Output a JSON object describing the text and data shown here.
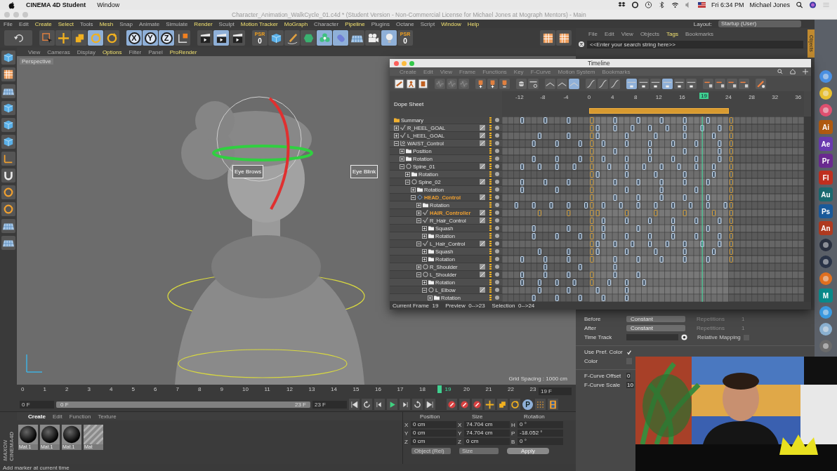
{
  "menubar": {
    "app": "CINEMA 4D Student",
    "menus": [
      "Window"
    ],
    "clock": "Fri 6:34 PM",
    "user": "Michael Jones"
  },
  "window": {
    "title": "Character_Animation_WalkCycle_01.c4d * (Student Version - Non-Commercial License for Michael Jones at Mograph Mentors) - Main"
  },
  "main_menu": [
    {
      "label": "File",
      "highlight": false
    },
    {
      "label": "Edit",
      "highlight": false
    },
    {
      "label": "Create",
      "highlight": true
    },
    {
      "label": "Select",
      "highlight": true
    },
    {
      "label": "Tools",
      "highlight": false
    },
    {
      "label": "Mesh",
      "highlight": true
    },
    {
      "label": "Snap",
      "highlight": false
    },
    {
      "label": "Animate",
      "highlight": false
    },
    {
      "label": "Simulate",
      "highlight": false
    },
    {
      "label": "Render",
      "highlight": true
    },
    {
      "label": "Sculpt",
      "highlight": false
    },
    {
      "label": "Motion Tracker",
      "highlight": true
    },
    {
      "label": "MoGraph",
      "highlight": true
    },
    {
      "label": "Character",
      "highlight": false
    },
    {
      "label": "Pipeline",
      "highlight": true
    },
    {
      "label": "Plugins",
      "highlight": false
    },
    {
      "label": "Octane",
      "highlight": false
    },
    {
      "label": "Script",
      "highlight": false
    },
    {
      "label": "Window",
      "highlight": true
    },
    {
      "label": "Help",
      "highlight": true
    }
  ],
  "layout": {
    "label": "Layout:",
    "value": "Startup (User)"
  },
  "toolbar": [
    {
      "kind": "undo",
      "selected": false
    },
    {
      "kind": "select",
      "selected": false
    },
    {
      "kind": "move",
      "selected": false
    },
    {
      "kind": "scale",
      "selected": false
    },
    {
      "kind": "rotate",
      "selected": true
    },
    {
      "kind": "rotate",
      "selected": false
    },
    {
      "kind": "axis",
      "label": "X",
      "selected": true
    },
    {
      "kind": "axis",
      "label": "Y",
      "selected": true
    },
    {
      "kind": "axis",
      "label": "Z",
      "selected": true
    },
    {
      "kind": "coords",
      "selected": false
    },
    {
      "kind": "clapper",
      "selected": false
    },
    {
      "kind": "clapper",
      "selected": true
    },
    {
      "kind": "clapper",
      "selected": false
    },
    {
      "kind": "psr",
      "label": "PSR",
      "value": "0",
      "selected": false
    },
    {
      "kind": "cube",
      "selected": false
    },
    {
      "kind": "pen",
      "selected": false
    },
    {
      "kind": "gem",
      "selected": false
    },
    {
      "kind": "flower",
      "selected": true
    },
    {
      "kind": "capsule",
      "selected": true
    },
    {
      "kind": "grid",
      "selected": false
    },
    {
      "kind": "camera",
      "selected": false
    },
    {
      "kind": "light",
      "selected": true
    },
    {
      "kind": "psr",
      "label": "PSR",
      "value": "0",
      "selected": false
    }
  ],
  "viewport": {
    "menu": [
      {
        "label": "View",
        "highlight": false
      },
      {
        "label": "Cameras",
        "highlight": false
      },
      {
        "label": "Display",
        "highlight": false
      },
      {
        "label": "Options",
        "highlight": true
      },
      {
        "label": "Filter",
        "highlight": false
      },
      {
        "label": "Panel",
        "highlight": false
      },
      {
        "label": "ProRender",
        "highlight": true
      }
    ],
    "camera": "Perspective",
    "labels": [
      "Eye Brows",
      "Eye Blink"
    ],
    "grid_spacing": "Grid Spacing : 1000 cm"
  },
  "object_manager": {
    "menu": [
      {
        "label": "File",
        "highlight": false
      },
      {
        "label": "Edit",
        "highlight": false
      },
      {
        "label": "View",
        "highlight": false
      },
      {
        "label": "Objects",
        "highlight": false
      },
      {
        "label": "Tags",
        "highlight": true
      },
      {
        "label": "Bookmarks",
        "highlight": false
      }
    ],
    "search": {
      "placeholder": "<<Enter your search string here>>"
    },
    "side_tab": "Objects"
  },
  "attributes": [
    {
      "kind": "dropdown",
      "label": "Before",
      "value": "Constant",
      "side_label": "Repetitions",
      "side_value": "1"
    },
    {
      "kind": "dropdown",
      "label": "After",
      "value": "Constant",
      "side_label": "Repetitions",
      "side_value": "1"
    },
    {
      "kind": "time_track",
      "label": "Time Track",
      "side_label": "Relative Mapping",
      "checked": false
    },
    {
      "kind": "checkbox",
      "label": "Use Pref. Color",
      "checked": true
    },
    {
      "kind": "color",
      "label": "Color"
    },
    {
      "kind": "number",
      "label": "F-Curve Offset",
      "value": "0"
    },
    {
      "kind": "number",
      "label": "F-Curve Scale",
      "value": "10"
    }
  ],
  "timeline": {
    "title": "Timeline",
    "menu": [
      "Create",
      "Edit",
      "View",
      "Frame",
      "Functions",
      "Key",
      "F-Curve",
      "Motion System",
      "Bookmarks"
    ],
    "tools": [
      {
        "kind": "link",
        "selected": false
      },
      {
        "kind": "person",
        "selected": false
      },
      {
        "kind": "film",
        "selected": false
      },
      {
        "kind": "wave",
        "selected": false
      },
      {
        "kind": "wave",
        "selected": false
      },
      {
        "kind": "wave",
        "selected": false
      },
      {
        "kind": "key-add",
        "selected": false
      },
      {
        "kind": "key-add",
        "selected": false
      },
      {
        "kind": "key-remove",
        "selected": false
      },
      {
        "kind": "key-move",
        "selected": false
      },
      {
        "kind": "key-zero",
        "selected": false
      },
      {
        "kind": "ease",
        "selected": false
      },
      {
        "kind": "ease",
        "selected": false
      },
      {
        "kind": "ease",
        "selected": true
      },
      {
        "kind": "curve",
        "selected": false
      },
      {
        "kind": "curve",
        "selected": false
      },
      {
        "kind": "curve",
        "selected": false
      },
      {
        "kind": "tangent",
        "selected": true
      },
      {
        "kind": "tangent",
        "selected": false
      },
      {
        "kind": "tangent",
        "selected": false
      },
      {
        "kind": "tangent",
        "selected": true
      },
      {
        "kind": "tangent",
        "selected": false
      },
      {
        "kind": "tangent",
        "selected": false
      },
      {
        "kind": "lock",
        "selected": false
      },
      {
        "kind": "lock",
        "selected": false
      },
      {
        "kind": "lock",
        "selected": false
      },
      {
        "kind": "lock",
        "selected": false
      },
      {
        "kind": "brush",
        "selected": false
      }
    ],
    "mode": "Dope Sheet",
    "ruler": [
      "-12",
      "-8",
      "-4",
      "0",
      "4",
      "8",
      "12",
      "16",
      "24",
      "28",
      "32",
      "36"
    ],
    "current_frame": "19",
    "rows": [
      {
        "name": "Summary",
        "kind": "summary",
        "selected": false
      },
      {
        "name": "R_HEEL_GOAL",
        "kind": "spline",
        "expanded": false,
        "selected": false
      },
      {
        "name": "L_HEEL_GOAL",
        "kind": "spline",
        "expanded": false,
        "selected": false
      },
      {
        "name": "WAIST_Control",
        "kind": "null",
        "expanded": true,
        "selected": false,
        "children": [
          {
            "name": "Position",
            "kind": "track",
            "expanded": false,
            "selected": false
          },
          {
            "name": "Rotation",
            "kind": "track",
            "expanded": false,
            "selected": false
          },
          {
            "name": "Spine_01",
            "kind": "joint",
            "expanded": true,
            "selected": false,
            "children": [
              {
                "name": "Rotation",
                "kind": "track",
                "expanded": false,
                "selected": false
              },
              {
                "name": "Spine_02",
                "kind": "joint",
                "expanded": true,
                "selected": false,
                "children": [
                  {
                    "name": "Rotation",
                    "kind": "track",
                    "expanded": false,
                    "selected": false
                  },
                  {
                    "name": "HEAD_Control",
                    "kind": "diamond",
                    "expanded": true,
                    "selected": true,
                    "children": [
                      {
                        "name": "Rotation",
                        "kind": "track",
                        "expanded": false,
                        "selected": false
                      },
                      {
                        "name": "HAIR_Controller",
                        "kind": "spline",
                        "expanded": false,
                        "selected": true
                      },
                      {
                        "name": "R_Hair_Control",
                        "kind": "spline",
                        "expanded": true,
                        "selected": false,
                        "children": [
                          {
                            "name": "Squash",
                            "kind": "track",
                            "expanded": false,
                            "selected": false
                          },
                          {
                            "name": "Rotation",
                            "kind": "track",
                            "expanded": false,
                            "selected": false
                          }
                        ]
                      },
                      {
                        "name": "L_Hair_Control",
                        "kind": "spline",
                        "expanded": true,
                        "selected": false,
                        "children": [
                          {
                            "name": "Squash",
                            "kind": "track",
                            "expanded": false,
                            "selected": false
                          },
                          {
                            "name": "Rotation",
                            "kind": "track",
                            "expanded": false,
                            "selected": false
                          }
                        ]
                      },
                      {
                        "name": "R_Shoulder",
                        "kind": "joint",
                        "expanded": false,
                        "selected": false
                      },
                      {
                        "name": "L_Shoulder",
                        "kind": "joint",
                        "expanded": true,
                        "selected": false,
                        "children": [
                          {
                            "name": "Rotation",
                            "kind": "track",
                            "expanded": false,
                            "selected": false
                          },
                          {
                            "name": "L_Elbow",
                            "kind": "joint",
                            "expanded": true,
                            "selected": false,
                            "children": [
                              {
                                "name": "Rotation",
                                "kind": "track",
                                "expanded": false,
                                "selected": false
                              }
                            ]
                          }
                        ]
                      }
                    ]
                  }
                ]
              }
            ]
          }
        ]
      }
    ],
    "status": [
      "Current Frame  19",
      "Preview  0-->23",
      "Selection  0-->24"
    ]
  },
  "frames": [
    {
      "label": "0",
      "selected": false
    },
    {
      "label": "1",
      "selected": false
    },
    {
      "label": "2",
      "selected": false
    },
    {
      "label": "3",
      "selected": false
    },
    {
      "label": "4",
      "selected": false
    },
    {
      "label": "5",
      "selected": false
    },
    {
      "label": "6",
      "selected": false
    },
    {
      "label": "7",
      "selected": false
    },
    {
      "label": "8",
      "selected": false
    },
    {
      "label": "9",
      "selected": false
    },
    {
      "label": "10",
      "selected": false
    },
    {
      "label": "11",
      "selected": false
    },
    {
      "label": "12",
      "selected": false
    },
    {
      "label": "13",
      "selected": false
    },
    {
      "label": "14",
      "selected": false
    },
    {
      "label": "15",
      "selected": false
    },
    {
      "label": "16",
      "selected": false
    },
    {
      "label": "17",
      "selected": false
    },
    {
      "label": "18",
      "selected": false
    },
    {
      "label": "19",
      "selected": true
    },
    {
      "label": "20",
      "selected": false
    },
    {
      "label": "21",
      "selected": false
    },
    {
      "label": "22",
      "selected": false
    },
    {
      "label": "23",
      "selected": false
    }
  ],
  "current_frame_field": "19 F",
  "transport": {
    "start": "0 F",
    "range_start": "0 F",
    "range_end": "23 F",
    "level": 1,
    "end": "23 F",
    "param_button": "P"
  },
  "materials": {
    "logo": [
      "MAXON",
      "CINEMA4D"
    ],
    "menu": [
      {
        "label": "Create",
        "highlight": true
      },
      {
        "label": "Edit",
        "highlight": false
      },
      {
        "label": "Function",
        "highlight": false
      },
      {
        "label": "Texture",
        "highlight": false
      }
    ],
    "items": [
      {
        "name": "Mat.1",
        "kind": "sphere"
      },
      {
        "name": "Mat.1",
        "kind": "sphere"
      },
      {
        "name": "Mat.1",
        "kind": "sphere"
      },
      {
        "name": "Mat",
        "kind": "empty"
      }
    ]
  },
  "coordinates": {
    "headers": [
      "Position",
      "Size",
      "Rotation"
    ],
    "rows": [
      {
        "cells": [
          {
            "axis": "X",
            "value": "0 cm"
          },
          {
            "axis": "X",
            "value": "74.704 cm"
          },
          {
            "axis": "H",
            "value": "0 °"
          }
        ]
      },
      {
        "cells": [
          {
            "axis": "Y",
            "value": "0 cm"
          },
          {
            "axis": "Y",
            "value": "74.704 cm"
          },
          {
            "axis": "P",
            "value": "-18.052 °"
          }
        ]
      },
      {
        "cells": [
          {
            "axis": "Z",
            "value": "0 cm"
          },
          {
            "axis": "Z",
            "value": "0 cm"
          },
          {
            "axis": "B",
            "value": "0 °"
          }
        ]
      }
    ],
    "modes": [
      "Object (Rel)",
      "Size"
    ],
    "apply": "Apply"
  },
  "status_bar": "Add marker at current time",
  "dock": [
    {
      "kind": "app",
      "color": "#4a90e2"
    },
    {
      "kind": "app",
      "color": "#e8c030"
    },
    {
      "kind": "app",
      "color": "#e05070"
    },
    {
      "kind": "letter",
      "label": "Ai",
      "color": "#b05a10"
    },
    {
      "kind": "letter",
      "label": "Ae",
      "color": "#6a3ab0"
    },
    {
      "kind": "letter",
      "label": "Pr",
      "color": "#6a2a90"
    },
    {
      "kind": "letter",
      "label": "Fl",
      "color": "#c03020"
    },
    {
      "kind": "letter",
      "label": "Au",
      "color": "#1a6a70"
    },
    {
      "kind": "letter",
      "label": "Ps",
      "color": "#1a5a9a"
    },
    {
      "kind": "letter",
      "label": "An",
      "color": "#b03a20"
    },
    {
      "kind": "app",
      "color": "#2a3040"
    },
    {
      "kind": "app",
      "color": "#2a3448"
    },
    {
      "kind": "app",
      "color": "#e07020"
    },
    {
      "kind": "letter",
      "label": "M",
      "color": "#0a8a8a"
    },
    {
      "kind": "app",
      "color": "#3a9ae0"
    },
    {
      "kind": "app",
      "color": "#8ab0d0"
    },
    {
      "kind": "app",
      "color": "#6a6a6a"
    }
  ]
}
